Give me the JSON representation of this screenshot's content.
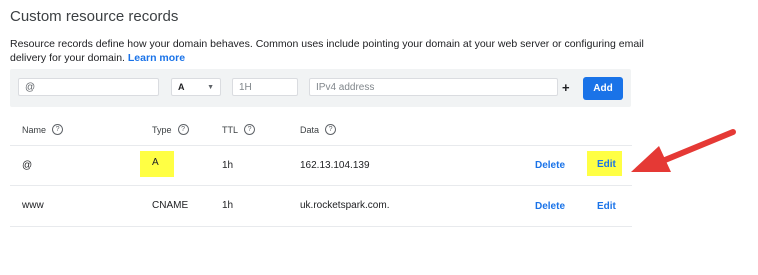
{
  "section": {
    "title": "Custom resource records",
    "description": "Resource records define how your domain behaves. Common uses include pointing your domain at your web server or configuring email delivery for your domain.",
    "learn_more": "Learn more"
  },
  "form": {
    "name_value": "@",
    "type_value": "A",
    "ttl_placeholder": "1H",
    "data_placeholder": "IPv4 address",
    "plus": "+",
    "add_label": "Add"
  },
  "table": {
    "headers": [
      "Name",
      "Type",
      "TTL",
      "Data"
    ],
    "help_glyph": "?",
    "rows": [
      {
        "name": "@",
        "type": "A",
        "ttl": "1h",
        "data": "162.13.104.139",
        "delete": "Delete",
        "edit": "Edit"
      },
      {
        "name": "www",
        "type": "CNAME",
        "ttl": "1h",
        "data": "uk.rocketspark.com.",
        "delete": "Delete",
        "edit": "Edit"
      }
    ]
  },
  "colors": {
    "accent": "#1a73e8",
    "highlight": "#ffff44",
    "annotation_arrow": "#e53935"
  },
  "icons": {
    "help": "help-circle-icon",
    "dropdown": "caret-down-icon",
    "annotation": "red-arrow-icon"
  }
}
